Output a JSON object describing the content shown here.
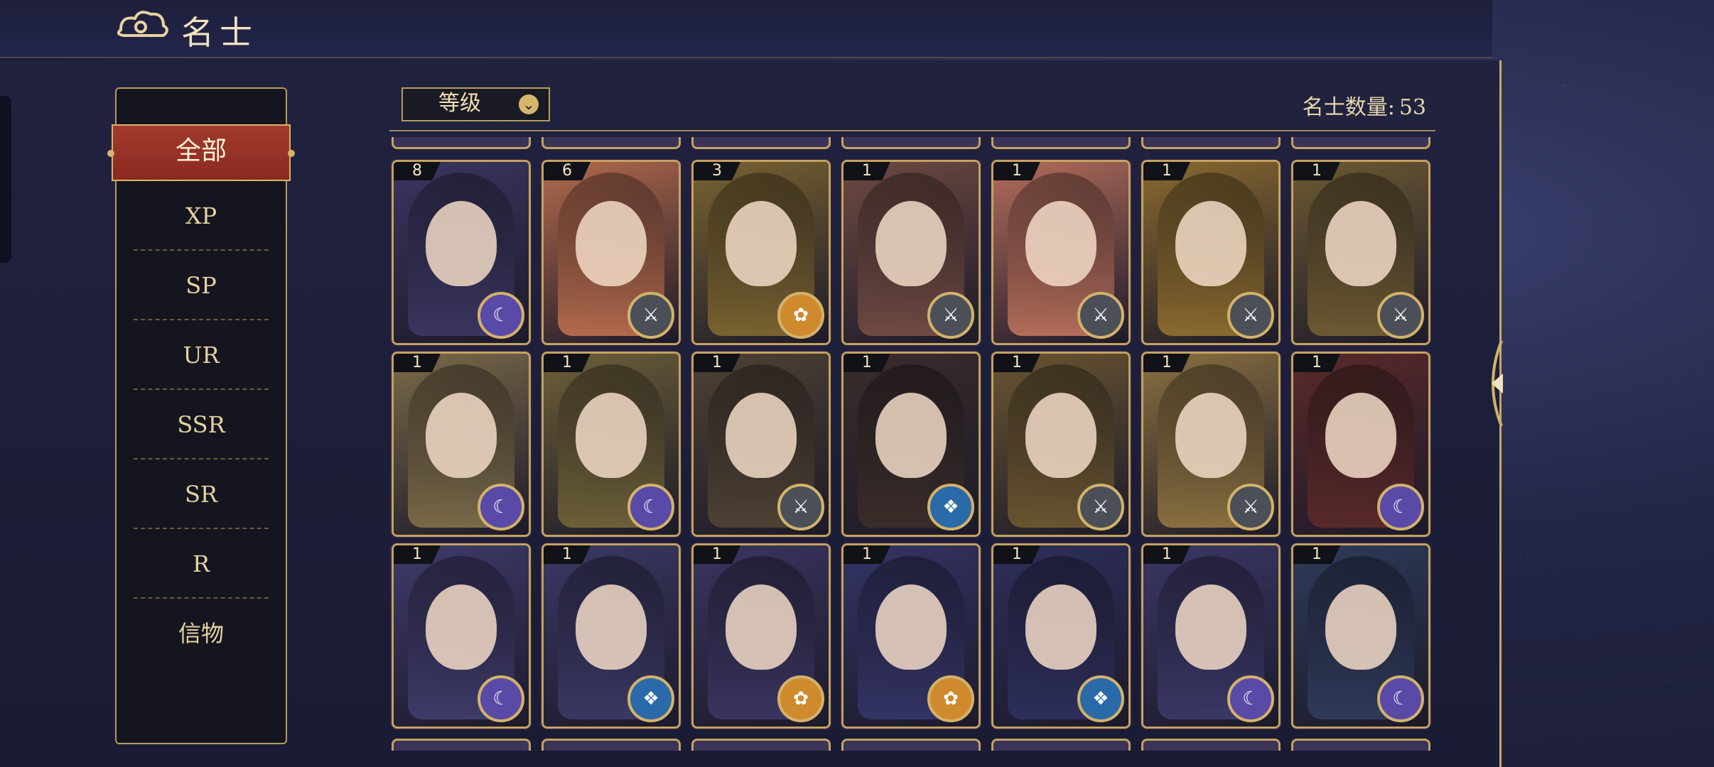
{
  "header": {
    "title": "名士"
  },
  "sidebar": {
    "active": "全部",
    "items": [
      {
        "label": "XP"
      },
      {
        "label": "SP"
      },
      {
        "label": "UR"
      },
      {
        "label": "SSR"
      },
      {
        "label": "SR"
      },
      {
        "label": "R"
      },
      {
        "label": "信物"
      }
    ]
  },
  "toolbar": {
    "sort_label": "等级",
    "count_label": "名士数量:",
    "count_value": "53"
  },
  "colors": {
    "accent_gold": "#c4a260",
    "active_tab": "#9b3228",
    "faction_purple": "#5a4aa8",
    "faction_gray": "#4b5058",
    "faction_orange": "#d08a2e",
    "faction_blue": "#2a6aa8"
  },
  "cards": [
    {
      "level": "8",
      "faction": "purple",
      "tone": "#3a3660"
    },
    {
      "level": "6",
      "faction": "gray",
      "tone": "#b36a4c"
    },
    {
      "level": "3",
      "faction": "orange",
      "tone": "#7a6330"
    },
    {
      "level": "1",
      "faction": "gray",
      "tone": "#6f4a42"
    },
    {
      "level": "1",
      "faction": "gray",
      "tone": "#b46d5a"
    },
    {
      "level": "1",
      "faction": "gray",
      "tone": "#8a6a2e"
    },
    {
      "level": "1",
      "faction": "gray",
      "tone": "#6d5a32"
    },
    {
      "level": "1",
      "faction": "purple",
      "tone": "#7a6a48"
    },
    {
      "level": "1",
      "faction": "purple",
      "tone": "#6d6038"
    },
    {
      "level": "1",
      "faction": "gray",
      "tone": "#4e4234"
    },
    {
      "level": "1",
      "faction": "blue",
      "tone": "#3a2d2a"
    },
    {
      "level": "1",
      "faction": "gray",
      "tone": "#6a5530"
    },
    {
      "level": "1",
      "faction": "gray",
      "tone": "#8a7040"
    },
    {
      "level": "1",
      "faction": "purple",
      "tone": "#5a2a2a"
    },
    {
      "level": "1",
      "faction": "purple",
      "tone": "#3e3b6a"
    },
    {
      "level": "1",
      "faction": "blue",
      "tone": "#3a3964"
    },
    {
      "level": "1",
      "faction": "orange",
      "tone": "#3a3560"
    },
    {
      "level": "1",
      "faction": "orange",
      "tone": "#343466"
    },
    {
      "level": "1",
      "faction": "blue",
      "tone": "#2e2f5c"
    },
    {
      "level": "1",
      "faction": "purple",
      "tone": "#3a3866"
    },
    {
      "level": "1",
      "faction": "purple",
      "tone": "#2f3a5a"
    }
  ]
}
